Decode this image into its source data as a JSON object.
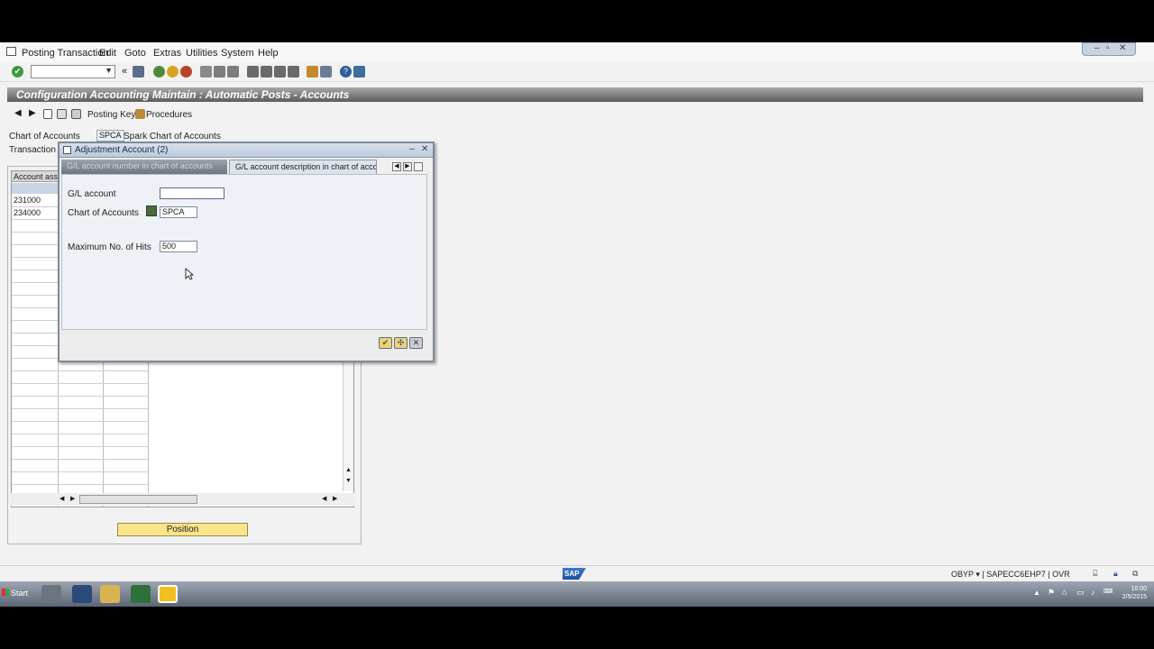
{
  "menu": {
    "items": [
      "Posting Transaction",
      "Edit",
      "Goto",
      "Extras",
      "Utilities",
      "System",
      "Help"
    ]
  },
  "title": "Configuration Accounting Maintain : Automatic Posts - Accounts",
  "app_toolbar": {
    "posting_key": "Posting Key",
    "procedures": "Procedures"
  },
  "form": {
    "chart_label": "Chart of Accounts",
    "chart_value": "SPCA",
    "chart_desc": "Spark Chart of Accounts",
    "transaction_label": "Transaction",
    "account_column": "Account ass",
    "rows": [
      "231000",
      "234000"
    ]
  },
  "position_button": "Position",
  "dialog": {
    "title": "Adjustment Account (2)",
    "tab1": "G/L account number in chart of accounts",
    "tab2": "G/L account description in chart of acco...",
    "gl_label": "G/L account",
    "gl_value": "",
    "chart_label": "Chart of Accounts",
    "chart_value": "SPCA",
    "hits_label": "Maximum No. of Hits",
    "hits_value": "500"
  },
  "status": {
    "sap_logo": "SAP",
    "system_info": "OBYP ▾ | SAPECC6EHP7 | OVR"
  },
  "taskbar": {
    "start": "Start",
    "clock_time": "16:00",
    "clock_date": "2/5/2015"
  }
}
